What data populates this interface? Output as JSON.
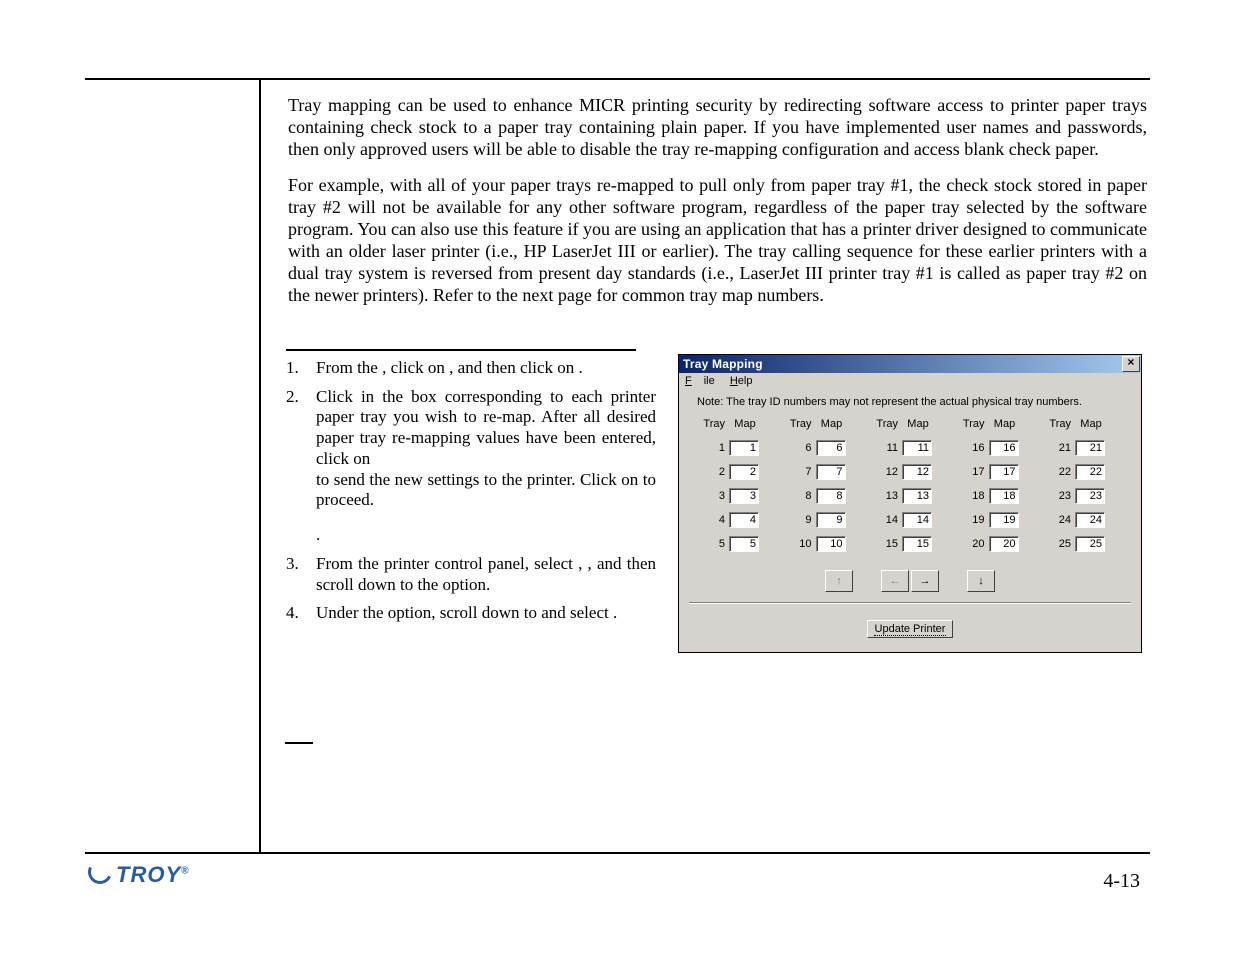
{
  "body": {
    "p1": "Tray mapping can be used to enhance MICR printing security by redirecting software access to printer paper trays containing check stock to a paper tray containing plain paper.  If you have implemented user names and passwords, then only approved users will be able to disable the tray re-mapping configuration and access blank check paper.",
    "p2": "For example, with all of your paper trays re-mapped to pull only from paper tray #1, the check stock stored in paper tray #2 will not be available for any other software program, regardless of the paper tray selected by the software program.  You can also use this feature if you are using an application that has a printer driver designed to communicate with an older laser printer (i.e., HP LaserJet III or earlier).  The tray calling sequence for these earlier printers with a dual tray system is reversed from present day standards (i.e., LaserJet III printer tray #1 is called as paper tray #2 on the newer printers).  Refer to the next page for common tray map numbers."
  },
  "steps": {
    "s1": "From  the                          ,  click  on          , and then click on                      .",
    "s2a": "Click  in  the                 box  corresponding  to each  printer  paper  tray  you  wish  to  re-map.  After   all   desired   paper   tray   re-mapping values  have  been  entered,  click  on",
    "s2b": "           to send the new settings to the printer.  Click on        to proceed.",
    "s2c": "                    .",
    "s3": "From   the   printer   control   panel,   select                               ,              , and then scroll down to the           option.",
    "s4": "Under the           option, scroll down to                                           and select           ."
  },
  "dialog": {
    "title": "Tray Mapping",
    "menu_file": "File",
    "menu_help": "Help",
    "note": "Note: The tray ID numbers may not represent the actual physical tray numbers.",
    "hdr_tray": "Tray",
    "hdr_map": "Map",
    "cols": [
      [
        {
          "t": "1",
          "m": "1"
        },
        {
          "t": "2",
          "m": "2"
        },
        {
          "t": "3",
          "m": "3"
        },
        {
          "t": "4",
          "m": "4"
        },
        {
          "t": "5",
          "m": "5"
        }
      ],
      [
        {
          "t": "6",
          "m": "6"
        },
        {
          "t": "7",
          "m": "7"
        },
        {
          "t": "8",
          "m": "8"
        },
        {
          "t": "9",
          "m": "9"
        },
        {
          "t": "10",
          "m": "10"
        }
      ],
      [
        {
          "t": "11",
          "m": "11"
        },
        {
          "t": "12",
          "m": "12"
        },
        {
          "t": "13",
          "m": "13"
        },
        {
          "t": "14",
          "m": "14"
        },
        {
          "t": "15",
          "m": "15"
        }
      ],
      [
        {
          "t": "16",
          "m": "16"
        },
        {
          "t": "17",
          "m": "17"
        },
        {
          "t": "18",
          "m": "18"
        },
        {
          "t": "19",
          "m": "19"
        },
        {
          "t": "20",
          "m": "20"
        }
      ],
      [
        {
          "t": "21",
          "m": "21"
        },
        {
          "t": "22",
          "m": "22"
        },
        {
          "t": "23",
          "m": "23"
        },
        {
          "t": "24",
          "m": "24"
        },
        {
          "t": "25",
          "m": "25"
        }
      ]
    ],
    "arrows": {
      "up": "↑",
      "left": "←",
      "right": "→",
      "down": "↓"
    },
    "update": "Update Printer"
  },
  "footer": {
    "logo": "TROY",
    "pagenum": "4-13"
  }
}
